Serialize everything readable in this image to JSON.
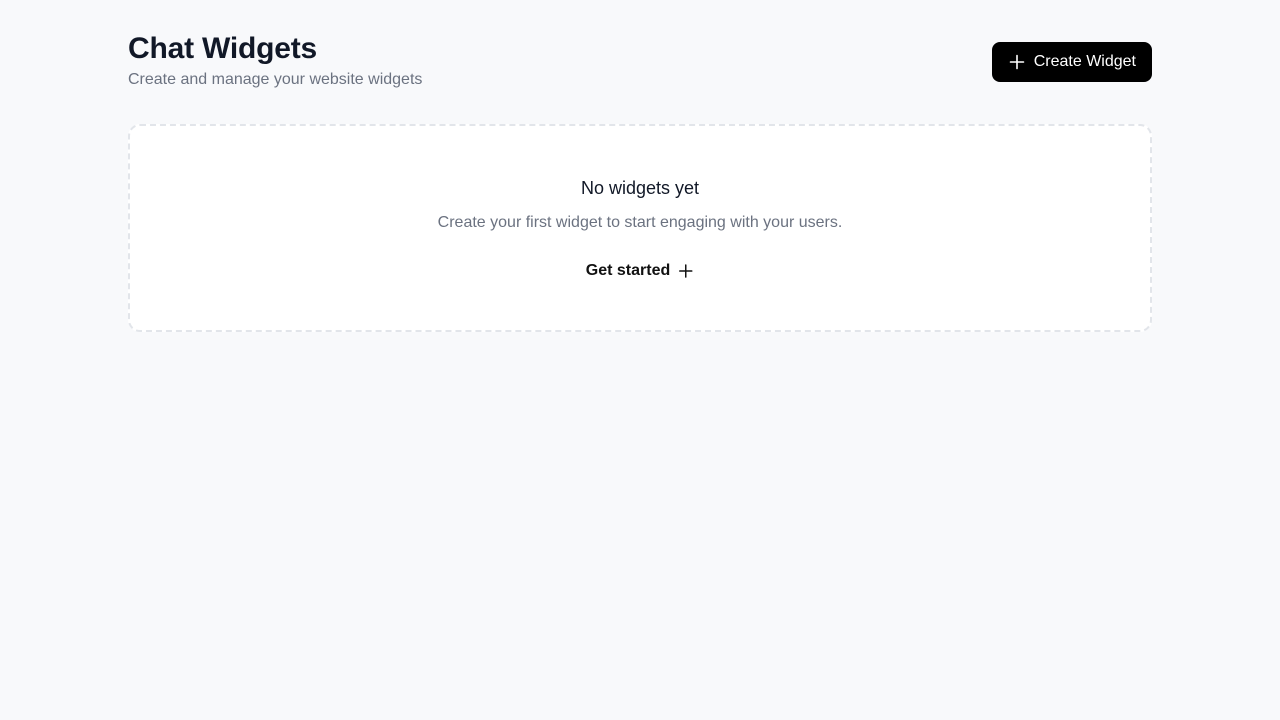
{
  "header": {
    "title": "Chat Widgets",
    "subtitle": "Create and manage your website widgets",
    "create_button": {
      "label": "Create Widget",
      "icon": "plus-icon"
    }
  },
  "empty_state": {
    "title": "No widgets yet",
    "description": "Create your first widget to start engaging with your users.",
    "action": {
      "label": "Get started",
      "icon": "plus-icon"
    }
  },
  "colors": {
    "background": "#f8f9fb",
    "card": "#ffffff",
    "primary_button": "#000000",
    "muted_text": "#6b7280",
    "heading_text": "#111827",
    "dashed_border": "#e2e5ea"
  }
}
